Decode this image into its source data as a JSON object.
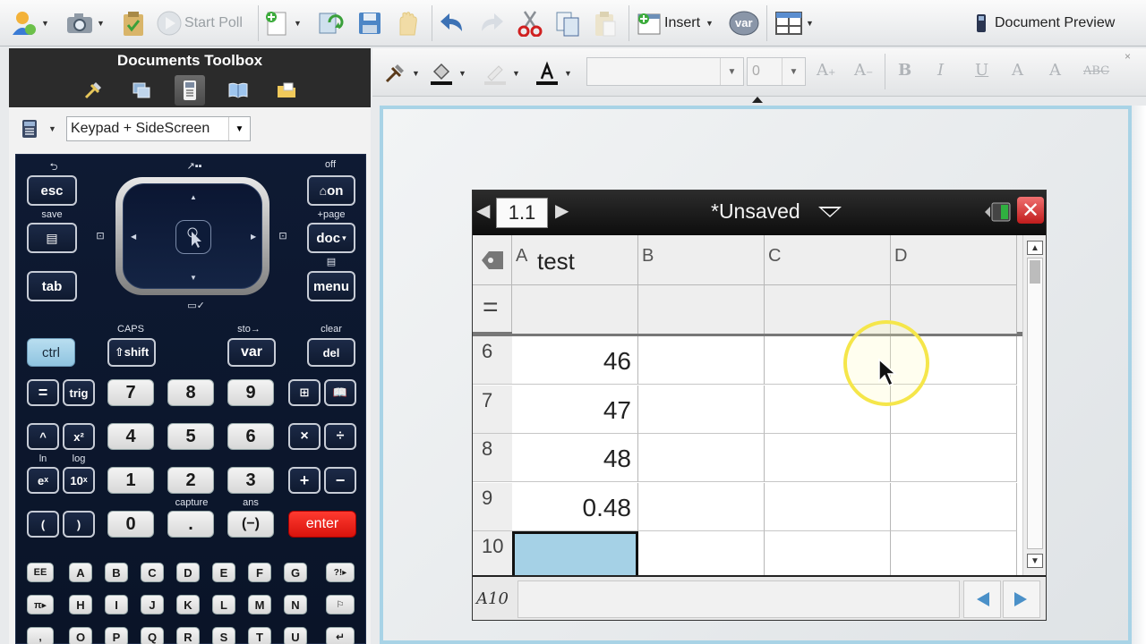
{
  "toolbar": {
    "start_poll_label": "Start Poll",
    "insert_label": "Insert",
    "var_label": "var",
    "document_preview_label": "Document Preview"
  },
  "toolbox": {
    "title": "Documents Toolbox",
    "keypad_select_value": "Keypad + SideScreen"
  },
  "format_bar": {
    "font_size_value": "0",
    "bold": "B",
    "italic": "I",
    "underline": "U",
    "text_a1": "A",
    "text_a2": "A",
    "strike": "ABC"
  },
  "keypad": {
    "esc": "esc",
    "on": "on",
    "off": "off",
    "save": "save",
    "plus_page": "+page",
    "doc": "doc",
    "tab": "tab",
    "menu": "menu",
    "caps": "CAPS",
    "sto": "sto→",
    "clear": "clear",
    "ctrl": "ctrl",
    "shift": "⇧shift",
    "var": "var",
    "del": "del",
    "eq": "=",
    "trig": "trig",
    "n7": "7",
    "n8": "8",
    "n9": "9",
    "caret": "^",
    "x2": "x²",
    "n4": "4",
    "n5": "5",
    "n6": "6",
    "times": "×",
    "div": "÷",
    "ex": "eˣ",
    "tenx": "10ˣ",
    "ln": "ln",
    "log": "log",
    "n1": "1",
    "n2": "2",
    "n3": "3",
    "plus": "+",
    "minus": "−",
    "lparen": "(",
    "rparen": ")",
    "capture": "capture",
    "ans": "ans",
    "n0": "0",
    "dot": ".",
    "neg": "(−)",
    "enter": "enter",
    "ee": "EE",
    "letters_row1": [
      "A",
      "B",
      "C",
      "D",
      "E",
      "F",
      "G"
    ],
    "letters_row2": [
      "H",
      "I",
      "J",
      "K",
      "L",
      "M",
      "N"
    ],
    "letters_row3": [
      "O",
      "P",
      "Q",
      "R",
      "S",
      "T",
      "U"
    ],
    "qmark": "?!▸"
  },
  "calculator": {
    "page_tab": "1.1",
    "document_title": "*Unsaved",
    "columns": [
      {
        "letter": "A",
        "name": "test"
      },
      {
        "letter": "B",
        "name": ""
      },
      {
        "letter": "C",
        "name": ""
      },
      {
        "letter": "D",
        "name": ""
      }
    ],
    "rows": [
      {
        "num": "6",
        "a": "46"
      },
      {
        "num": "7",
        "a": "47"
      },
      {
        "num": "8",
        "a": "48"
      },
      {
        "num": "9",
        "a": "0.48"
      },
      {
        "num": "10",
        "a": ""
      }
    ],
    "current_cell": "A10"
  },
  "colors": {
    "accent_blue": "#a5d1e6",
    "enter_red": "#e3211a",
    "keypad_bg": "#0e1a33",
    "close_red": "#d93030",
    "cursor_highlight": "#f5e64a"
  }
}
